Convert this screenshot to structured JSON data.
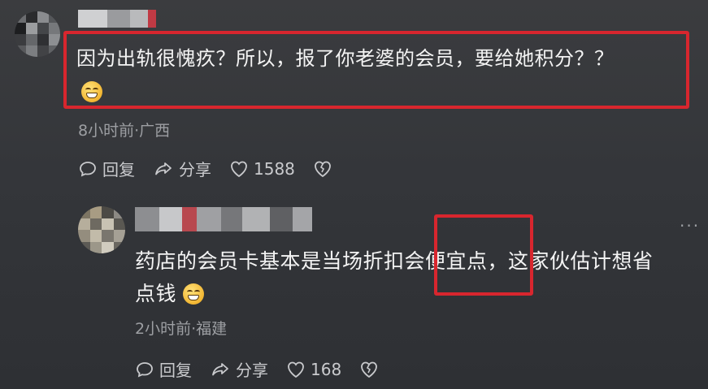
{
  "comment1": {
    "text_line1": "因为出轨很愧疚？所以，报了你老婆的会员，要给她积分？？",
    "meta": "8小时前·广西",
    "reply_label": "回复",
    "share_label": "分享",
    "like_count": "1588",
    "emoji_icon": "grinning-sweat-emoji"
  },
  "comment2": {
    "text_line1": "药店的会员卡基本是当场折扣会便宜点，这家伙估计想省",
    "text_line2": "点钱",
    "meta": "2小时前·福建",
    "reply_label": "回复",
    "share_label": "分享",
    "like_count": "168",
    "more_label": "···",
    "emoji_icon": "grinning-sweat-emoji"
  },
  "colors": {
    "background": "#36373b",
    "highlight_box": "#d8262e",
    "meta_text": "#9d9fa3"
  }
}
